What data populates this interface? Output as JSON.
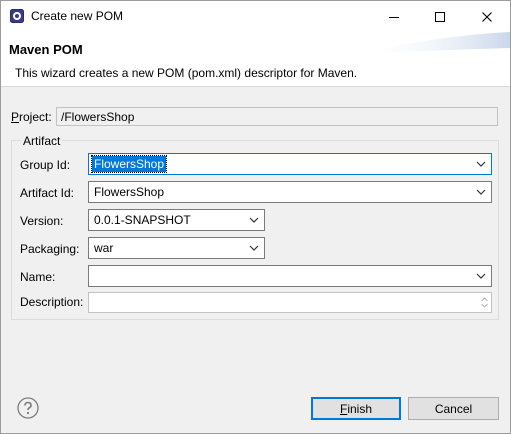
{
  "window": {
    "title": "Create new POM"
  },
  "banner": {
    "title": "Maven POM",
    "description": "This wizard creates a new POM (pom.xml) descriptor for Maven."
  },
  "project": {
    "label_first": "P",
    "label_rest": "roject:",
    "value": "/FlowersShop"
  },
  "artifact": {
    "group_label": "Artifact",
    "group_id": {
      "label": "Group Id:",
      "value": "FlowersShop"
    },
    "artifact_id": {
      "label": "Artifact Id:",
      "value": "FlowersShop"
    },
    "version": {
      "label": "Version:",
      "value": "0.0.1-SNAPSHOT"
    },
    "packaging": {
      "label": "Packaging:",
      "value": "war"
    },
    "name": {
      "label": "Name:",
      "value": ""
    },
    "description": {
      "label": "Description:",
      "value": ""
    }
  },
  "buttons": {
    "finish_first": "F",
    "finish_rest": "inish",
    "cancel": "Cancel"
  },
  "icons": {
    "app": "eclipse-gear-icon",
    "minimize": "minimize-icon",
    "maximize": "maximize-icon",
    "close": "close-icon",
    "help": "help-icon",
    "dropdown": "chevron-down-icon"
  },
  "colors": {
    "accent": "#0078d7",
    "selection": "#0078d7",
    "dialog_bg": "#f0f0f0"
  }
}
